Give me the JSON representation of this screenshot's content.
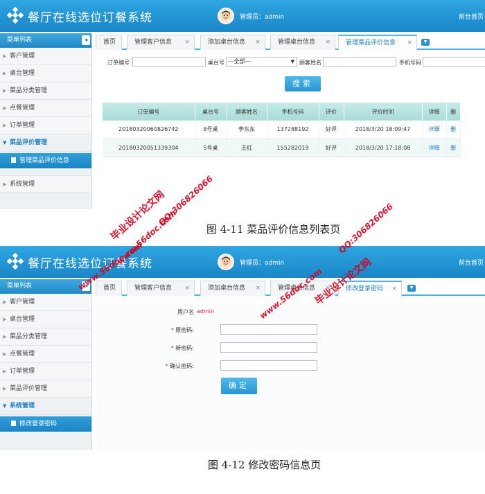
{
  "app": {
    "title": "餐厅在线选位订餐系统",
    "admin_label": "管理员：admin",
    "front_link": "前台首页"
  },
  "sidebar": {
    "heading": "菜单列表",
    "collapse_glyph": "◂"
  },
  "screen1": {
    "menu": [
      {
        "label": "客户管理",
        "state": "collapsed"
      },
      {
        "label": "桌台管理",
        "state": "collapsed"
      },
      {
        "label": "菜品分类管理",
        "state": "collapsed"
      },
      {
        "label": "点餐管理",
        "state": "collapsed"
      },
      {
        "label": "订单管理",
        "state": "collapsed"
      },
      {
        "label": "菜品评价管理",
        "state": "expanded",
        "sub": "管理菜品评价信息"
      },
      {
        "label": "系统管理",
        "state": "collapsed"
      }
    ],
    "tabs": [
      "首页",
      "管理客户信息",
      "添加桌台信息",
      "管理桌台信息",
      "管理菜品评价信息"
    ],
    "active_tab": "管理菜品评价信息",
    "search": {
      "order_no_label": "订单编号",
      "table_label": "桌台号",
      "table_select": "---全部---",
      "customer_label": "顾客姓名",
      "phone_label": "手机号码",
      "button": "搜索"
    },
    "table": {
      "columns": [
        "订单编号",
        "桌台号",
        "顾客姓名",
        "手机号码",
        "评价",
        "评价时间",
        "详细",
        "删"
      ],
      "rows": [
        [
          "20180320060826742",
          "8号桌",
          "李东东",
          "137288192",
          "好评",
          "2018/3/20 18:09:47",
          "详细",
          "删"
        ],
        [
          "20180320051339304",
          "5号桌",
          "王红",
          "155282019",
          "好评",
          "2018/3/20 17:18:08",
          "详细",
          "删"
        ]
      ]
    },
    "caption": "图 4-11 菜品评价信息列表页"
  },
  "screen2": {
    "menu": [
      {
        "label": "客户管理",
        "state": "collapsed"
      },
      {
        "label": "桌台管理",
        "state": "collapsed"
      },
      {
        "label": "菜品分类管理",
        "state": "collapsed"
      },
      {
        "label": "点餐管理",
        "state": "collapsed"
      },
      {
        "label": "订单管理",
        "state": "collapsed"
      },
      {
        "label": "菜品评价管理",
        "state": "collapsed"
      },
      {
        "label": "系统管理",
        "state": "expanded",
        "sub": "修改登录密码"
      }
    ],
    "tabs": [
      "首页",
      "管理客户信息",
      "添加桌台信息",
      "管理桌台信息",
      "修改登录密码"
    ],
    "active_tab": "修改登录密码",
    "form": {
      "username_label": "用户名",
      "username_value": "admin",
      "old_pwd_label": "原密码:",
      "new_pwd_label": "新密码:",
      "confirm_pwd_label": "确认密码:",
      "required_mark": "*",
      "button": "确定"
    },
    "caption": "图 4-12 修改密码信息页"
  },
  "watermark": {
    "site": "www.56doc.com",
    "qq": "QQ:306826066",
    "name": "毕业设计论文网",
    "color": "#d4001a"
  },
  "colors": {
    "header": "#1f90d0",
    "accent": "#2796d4",
    "table_header": "#b7e3e0"
  }
}
